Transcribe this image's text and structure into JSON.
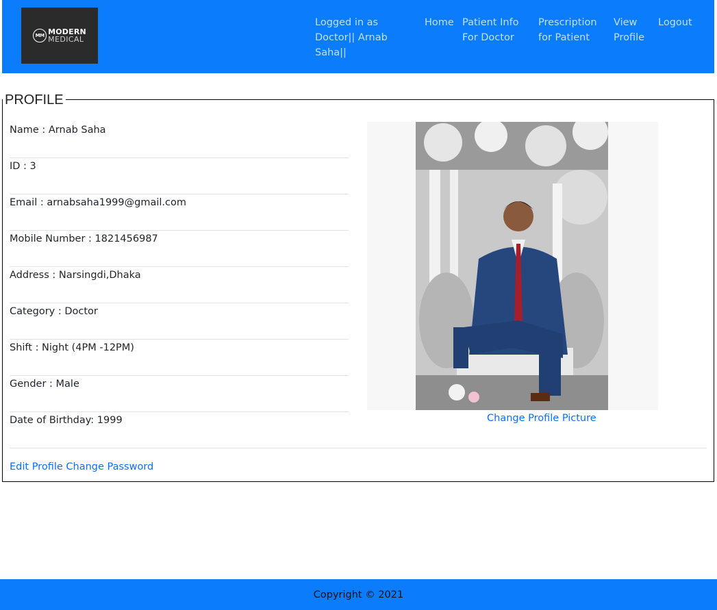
{
  "brand": {
    "monogram": "MM",
    "line1": "MODERN",
    "line2": "MEDICAL"
  },
  "nav": {
    "user_status": "Logged in as Doctor|| Arnab Saha||",
    "home": "Home",
    "patient_info": "Patient Info For Doctor",
    "prescription": "Prescription for Patient",
    "view_profile": "View Profile",
    "logout": "Logout"
  },
  "profile": {
    "title": "PROFILE",
    "fields": [
      "Name : Arnab Saha",
      "ID : 3",
      "Email : arnabsaha1999@gmail.com",
      "Mobile Number : 1821456987",
      "Address : Narsingdi,Dhaka",
      "Category : Doctor",
      "Shift : Night (4PM -12PM)",
      "Gender : Male",
      "Date of Birthday: 1999"
    ],
    "change_picture": "Change Profile Picture",
    "edit_profile": "Edit Profile",
    "change_password": "Change Password"
  },
  "footer": {
    "copyright": "Copyright © 2021"
  },
  "colors": {
    "primary": "#0a7cfc",
    "link": "#0d6efd",
    "nav_text": "#bfe0ff"
  }
}
